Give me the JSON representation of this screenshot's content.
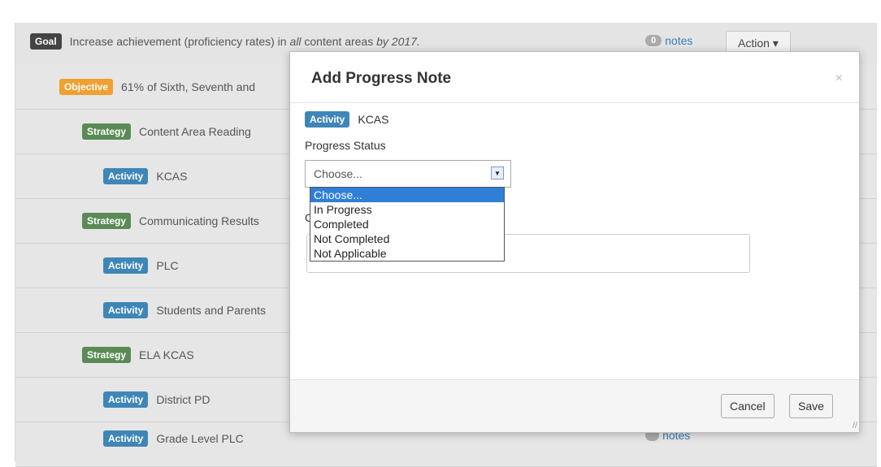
{
  "goal": {
    "label": "Goal",
    "text_before": "Increase achievement (proficiency rates) in ",
    "text_italic1": "all",
    "text_middle": " content areas ",
    "text_italic2": "by 2017.",
    "badge_count": "0",
    "notes_label": "notes",
    "action_label": "Action ▾"
  },
  "rows": [
    {
      "type": "Objective",
      "text": "61% of Sixth, Seventh and"
    },
    {
      "type": "Strategy",
      "text": "Content Area Reading"
    },
    {
      "type": "Activity",
      "text": "KCAS"
    },
    {
      "type": "Strategy",
      "text": "Communicating Results"
    },
    {
      "type": "Activity",
      "text": "PLC"
    },
    {
      "type": "Activity",
      "text": "Students and Parents"
    },
    {
      "type": "Strategy",
      "text": "ELA KCAS"
    },
    {
      "type": "Activity",
      "text": "District PD"
    },
    {
      "type": "Activity",
      "text": "Grade Level PLC"
    }
  ],
  "bottom_notes": "notes",
  "modal": {
    "title": "Add Progress Note",
    "close": "×",
    "activity_label": "Activity",
    "activity_name": "KCAS",
    "status_label": "Progress Status",
    "select_value": "Choose...",
    "options": [
      "Choose...",
      "In Progress",
      "Completed",
      "Not Completed",
      "Not Applicable"
    ],
    "comment_label_partial": "C",
    "cancel": "Cancel",
    "save": "Save"
  }
}
